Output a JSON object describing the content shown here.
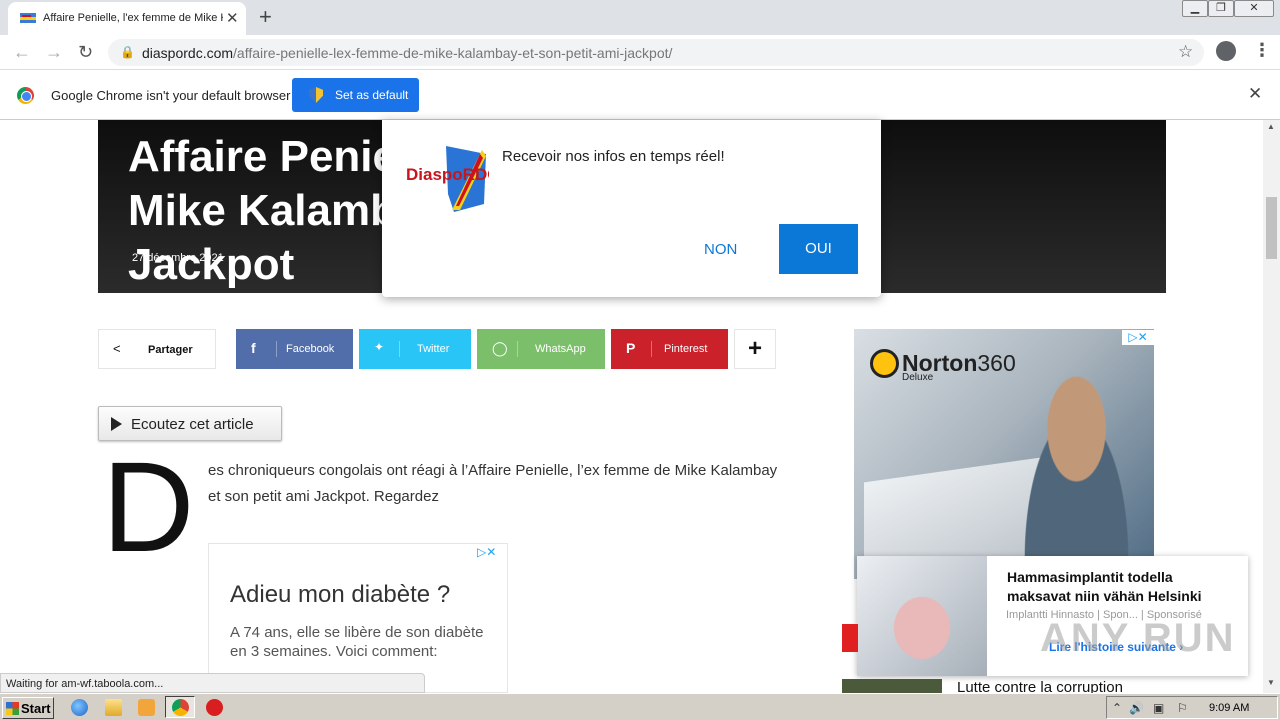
{
  "browser": {
    "tab_title": "Affaire Penielle, l'ex femme de Mike K",
    "tab_close": "✕",
    "new_tab": "+",
    "url_domain": "diaspordc.com",
    "url_path": "/affaire-penielle-lex-femme-de-mike-kalambay-et-son-petit-ami-jackpot/",
    "win_minimize": "▁",
    "win_restore": "❐",
    "win_close": "✕"
  },
  "infobar": {
    "message": "Google Chrome isn't your default browser",
    "button": "Set as default",
    "close": "✕"
  },
  "article": {
    "title": "Affaire Penielle, l'ex femme de Mike Kalambay et son petit ami Jackpot",
    "date": "27 décembre 2021",
    "share_label": "Partager",
    "share_buttons": [
      {
        "label": "Facebook",
        "icon": "f",
        "color": "#516eab"
      },
      {
        "label": "Twitter",
        "icon": "🐦",
        "color": "#29c5f6"
      },
      {
        "label": "WhatsApp",
        "icon": "◯",
        "color": "#7bbf6a"
      },
      {
        "label": "Pinterest",
        "icon": "P",
        "color": "#ca212a"
      }
    ],
    "more_share": "+",
    "listen": "Ecoutez cet article",
    "dropcap": "D",
    "body": "es chroniqueurs congolais ont réagi à l’Affaire Penielle, l’ex femme de Mike Kalambay et son petit ami Jackpot. Regardez"
  },
  "inline_ad": {
    "adchoices": "▷✕",
    "title": "Adieu mon diabète ?",
    "text": "A 74 ans, elle se libère de son diabète en 3 semaines. Voici comment:"
  },
  "side_ad": {
    "brand": "Norton",
    "brand_num": "360",
    "sub": "Deluxe",
    "adchoices": "▷✕"
  },
  "popup": {
    "logo_text": "DiaspoRDC",
    "message": "Recevoir nos infos en temps réel!",
    "no": "NON",
    "yes": "OUI"
  },
  "taboola": {
    "headline": "Hammasimplantit todella maksavat niin vähän Helsinki",
    "source": "Implantti Hinnasto | Spon... | Sponsorisé",
    "cta": "Lire l'histoire suivante ›"
  },
  "watermark": "ANY RUN",
  "next_article": "Lutte contre la corruption",
  "status_text": "Waiting for am-wf.taboola.com...",
  "taskbar": {
    "start": "Start",
    "clock": "9:09 AM"
  },
  "colors": {
    "accent": "#1a73e8",
    "popup_blue": "#0b77d6"
  }
}
